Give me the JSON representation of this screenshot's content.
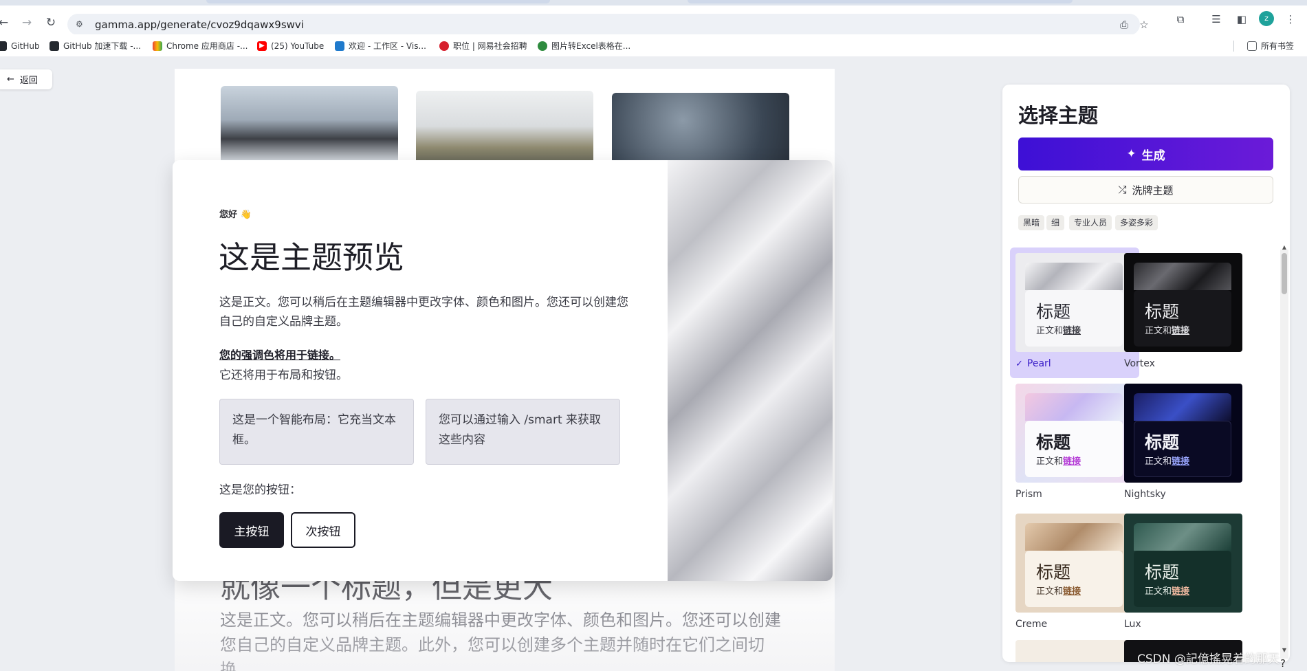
{
  "browser": {
    "url": "gamma.app/generate/cvoz9dqawx9swvi",
    "profile_initial": "z",
    "bookmarks": [
      {
        "label": "GitHub",
        "icon": "github-icon"
      },
      {
        "label": "GitHub 加速下载 -...",
        "icon": "github-icon"
      },
      {
        "label": "Chrome 应用商店 -...",
        "icon": "chrome-webstore-icon"
      },
      {
        "label": "(25) YouTube",
        "icon": "youtube-icon"
      },
      {
        "label": "欢迎 - 工作区 - Vis...",
        "icon": "vscode-icon"
      },
      {
        "label": "职位 | 网易社会招聘",
        "icon": "netease-icon"
      },
      {
        "label": "图片转Excel表格在...",
        "icon": "excel-icon"
      }
    ],
    "all_bookmarks": "所有书签"
  },
  "page": {
    "back_label": "返回"
  },
  "background_card": {
    "heading": "就像一个标题，但是更大",
    "body": "这是正文。您可以稍后在主题编辑器中更改字体、颜色和图片。您还可以创建您自己的自定义品牌主题。此外，您可以创建多个主题并随时在它们之间切换。"
  },
  "preview": {
    "greeting": "您好 👋",
    "title": "这是主题预览",
    "body1": "这是正文。您可以稍后在主题编辑器中更改字体、颜色和图片。您还可以创建您自己的自定义品牌主题。",
    "accent": "您的强调色将用于链接。",
    "body2": "它还将用于布局和按钮。",
    "smart_box_1": "这是一个智能布局：它充当文本框。",
    "smart_box_2": "您可以通过输入 /smart 来获取这些内容",
    "buttons_label": "这是您的按钮：",
    "primary_button": "主按钮",
    "secondary_button": "次按钮"
  },
  "sidebar": {
    "title": "选择主题",
    "generate_button": "生成",
    "shuffle_button": "洗牌主题",
    "filters": [
      "黑暗",
      "细",
      "专业人员",
      "多姿多彩"
    ],
    "themes": [
      {
        "name": "Pearl",
        "title": "标题",
        "body": "正文和",
        "link": "链接",
        "selected": true
      },
      {
        "name": "Vortex",
        "title": "标题",
        "body": "正文和",
        "link": "链接",
        "selected": false
      },
      {
        "name": "Prism",
        "title": "标题",
        "body": "正文和",
        "link": "链接",
        "selected": false
      },
      {
        "name": "Nightsky",
        "title": "标题",
        "body": "正文和",
        "link": "链接",
        "selected": false
      },
      {
        "name": "Creme",
        "title": "标题",
        "body": "正文和",
        "link": "链接",
        "selected": false
      },
      {
        "name": "Lux",
        "title": "标题",
        "body": "正文和",
        "link": "链接",
        "selected": false
      }
    ]
  },
  "colors": {
    "accent_purple": "#4a14d8",
    "dark_button": "#1a1a24",
    "selected_theme": "#d9d1fb"
  },
  "watermark": "CSDN @記億搖晃着的那天"
}
